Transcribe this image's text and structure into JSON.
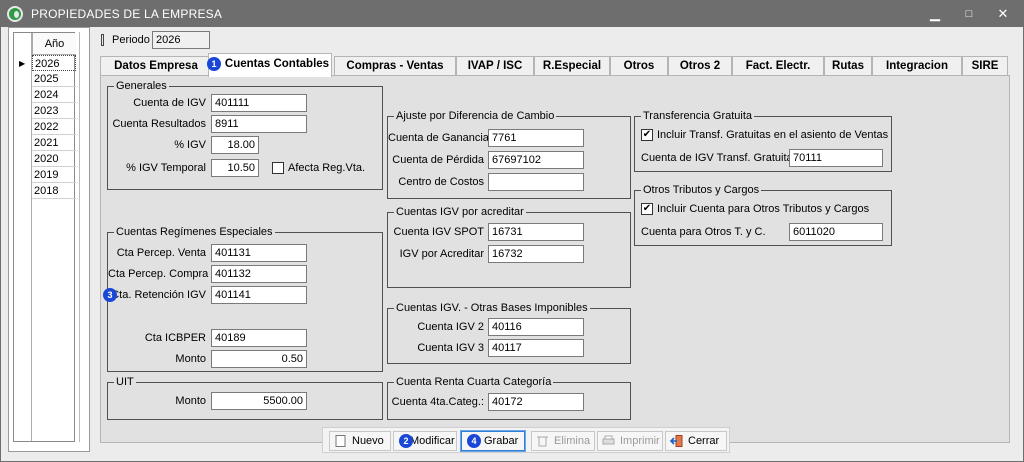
{
  "window": {
    "title": "PROPIEDADES DE LA EMPRESA",
    "minimize": "▁",
    "maximize": "□",
    "close": "✕"
  },
  "years": {
    "header": "Año",
    "rows": [
      "2026",
      "2025",
      "2024",
      "2023",
      "2022",
      "2021",
      "2020",
      "2019",
      "2018"
    ],
    "selected": "2026"
  },
  "periodo": {
    "label": "Periodo",
    "value": "2026"
  },
  "tabs": [
    "Datos Empresa",
    "Cuentas Contables",
    "Compras - Ventas",
    "IVAP / ISC",
    "R.Especial",
    "Otros",
    "Otros 2",
    "Fact. Electr.",
    "Rutas",
    "Integracion",
    "SIRE"
  ],
  "active_tab": "Cuentas Contables",
  "generales": {
    "title": "Generales",
    "cuenta_igv_label": "Cuenta de IGV",
    "cuenta_igv": "401111",
    "cuenta_res_label": "Cuenta Resultados",
    "cuenta_res": "8911",
    "pigv_label": "% IGV",
    "pigv": "18.00",
    "pigv_temp_label": "% IGV Temporal",
    "pigv_temp": "10.50",
    "afecta_label": "Afecta Reg.Vta."
  },
  "regimenes": {
    "title": "Cuentas Regímenes Especiales",
    "percep_venta_label": "Cta Percep. Venta",
    "percep_venta": "401131",
    "percep_compra_label": "Cta Percep. Compra",
    "percep_compra": "401132",
    "retencion_label": "Cta. Retención IGV",
    "retencion": "401141",
    "icbper_label": "Cta ICBPER",
    "icbper": "40189",
    "monto_label": "Monto",
    "monto": "0.50"
  },
  "uit": {
    "title": "UIT",
    "monto_label": "Monto",
    "monto": "5500.00"
  },
  "ajuste": {
    "title": "Ajuste por Diferencia de Cambio",
    "ganancia_label": "Cuenta de Ganancia",
    "ganancia": "7761",
    "perdida_label": "Cuenta de Pérdida",
    "perdida": "67697102",
    "centro_label": "Centro de Costos",
    "centro": ""
  },
  "igv_acreditar": {
    "title": "Cuentas IGV por acreditar",
    "spot_label": "Cuenta IGV SPOT",
    "spot": "16731",
    "acreditar_label": "IGV por Acreditar",
    "acreditar": "16732"
  },
  "otras_bases": {
    "title": "Cuentas IGV. - Otras Bases Imponibles",
    "igv2_label": "Cuenta IGV 2",
    "igv2": "40116",
    "igv3_label": "Cuenta IGV 3",
    "igv3": "40117"
  },
  "renta_cuarta": {
    "title": "Cuenta Renta Cuarta Categoría",
    "label": "Cuenta 4ta.Categ.:",
    "value": "40172"
  },
  "transferencia": {
    "title": "Transferencia Gratuita",
    "incluir_label": "Incluir Transf. Gratuitas en el asiento de Ventas",
    "cuenta_label": "Cuenta de IGV Transf. Gratuita",
    "cuenta": "70111"
  },
  "otros_tributos": {
    "title": "Otros Tributos y Cargos",
    "incluir_label": "Incluir Cuenta para Otros Tributos y Cargos",
    "cuenta_label": "Cuenta para Otros T. y C.",
    "cuenta": "6011020"
  },
  "buttons": {
    "nuevo": "Nuevo",
    "modificar": "Modificar",
    "grabar": "Grabar",
    "elimina": "Elimina",
    "imprimir": "Imprimir",
    "cerrar": "Cerrar"
  },
  "badges": {
    "b1": "1",
    "b2": "2",
    "b3": "3",
    "b4": "4"
  },
  "colors": {
    "titlebar": "#6e6e6e",
    "badge": "#1a47d6",
    "panel": "#e1e1e1"
  }
}
